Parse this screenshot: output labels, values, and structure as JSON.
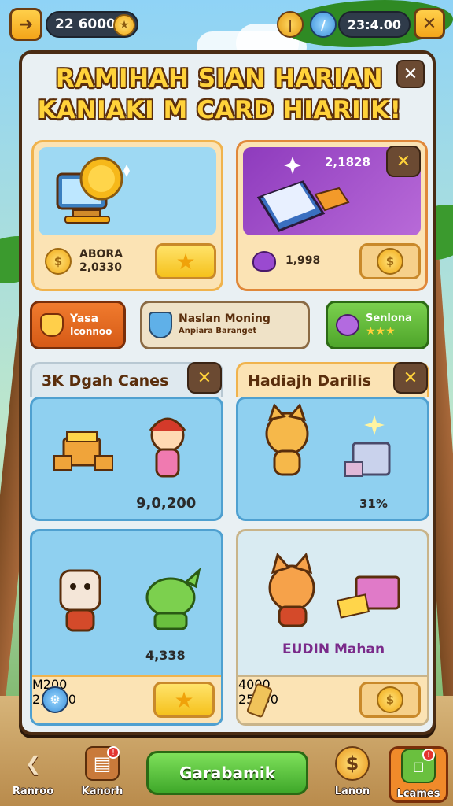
{
  "topbar": {
    "coins": "22 6000",
    "timer": "23:4.00"
  },
  "panel": {
    "title_line1": "RAMIHAH SIAN HARIAN",
    "title_line2": "KANIAKI M CARD HIARIIK!"
  },
  "cards": {
    "card1": {
      "line1": "ABORA",
      "line2": "2,0330"
    },
    "card2": {
      "badge_value": "2,1828",
      "value": "1,998"
    }
  },
  "mid_buttons": {
    "left": {
      "line1": "Yasa",
      "line2": "Iconnoo"
    },
    "center": {
      "line1": "Naslan Moning",
      "line2": "Anpiara Baranget"
    },
    "right": {
      "line1": "Senlona"
    }
  },
  "sections": {
    "left_header": "3K Dgah Canes",
    "right_header": "Hadiajh Darilis",
    "box1_value": "9,0,200",
    "box2_value": "31%",
    "box3_value": "4,338",
    "box4_label": "EUDIN Mahan",
    "box3_footer": {
      "line1": "M200",
      "line2": "2,6330"
    },
    "box4_footer": {
      "line1": "4000",
      "line2": "25050"
    }
  },
  "bottom_nav": {
    "items": [
      {
        "label": "Ranroo",
        "icon": "back-arrow-icon"
      },
      {
        "label": "Kanorh",
        "icon": "book-icon"
      },
      {
        "label": "Lanon",
        "icon": "coin-icon"
      },
      {
        "label": "Lcames",
        "icon": "money-icon"
      }
    ],
    "cta": "Garabamik"
  },
  "colors": {
    "title_yellow": "#ffd23a",
    "outline_brown": "#4a2c14",
    "cta_green": "#4fb830"
  }
}
